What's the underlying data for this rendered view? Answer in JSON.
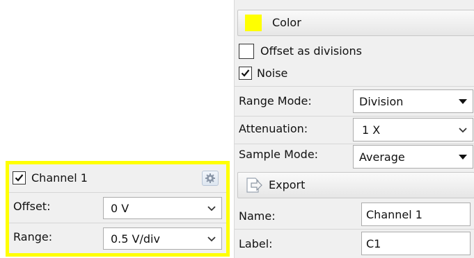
{
  "channel_widget": {
    "enabled": true,
    "name": "Channel 1",
    "settings_icon": "gear-icon",
    "highlight_color": "#ffff00",
    "offset": {
      "label": "Offset:",
      "value": "0 V"
    },
    "range": {
      "label": "Range:",
      "value": "0.5 V/div"
    }
  },
  "properties": {
    "color_button": {
      "label": "Color",
      "swatch_color": "#ffff00"
    },
    "offset_as_divisions": {
      "label": "Offset as divisions",
      "checked": false
    },
    "noise": {
      "label": "Noise",
      "checked": true
    },
    "range_mode": {
      "label": "Range Mode:",
      "value": "Division"
    },
    "attenuation": {
      "label": "Attenuation:",
      "value": "1 X"
    },
    "sample_mode": {
      "label": "Sample Mode:",
      "value": "Average"
    },
    "export_button": {
      "label": "Export",
      "icon": "export-icon"
    },
    "name_field": {
      "label": "Name:",
      "value": "Channel 1"
    },
    "label_field": {
      "label": "Label:",
      "value": "C1"
    }
  }
}
